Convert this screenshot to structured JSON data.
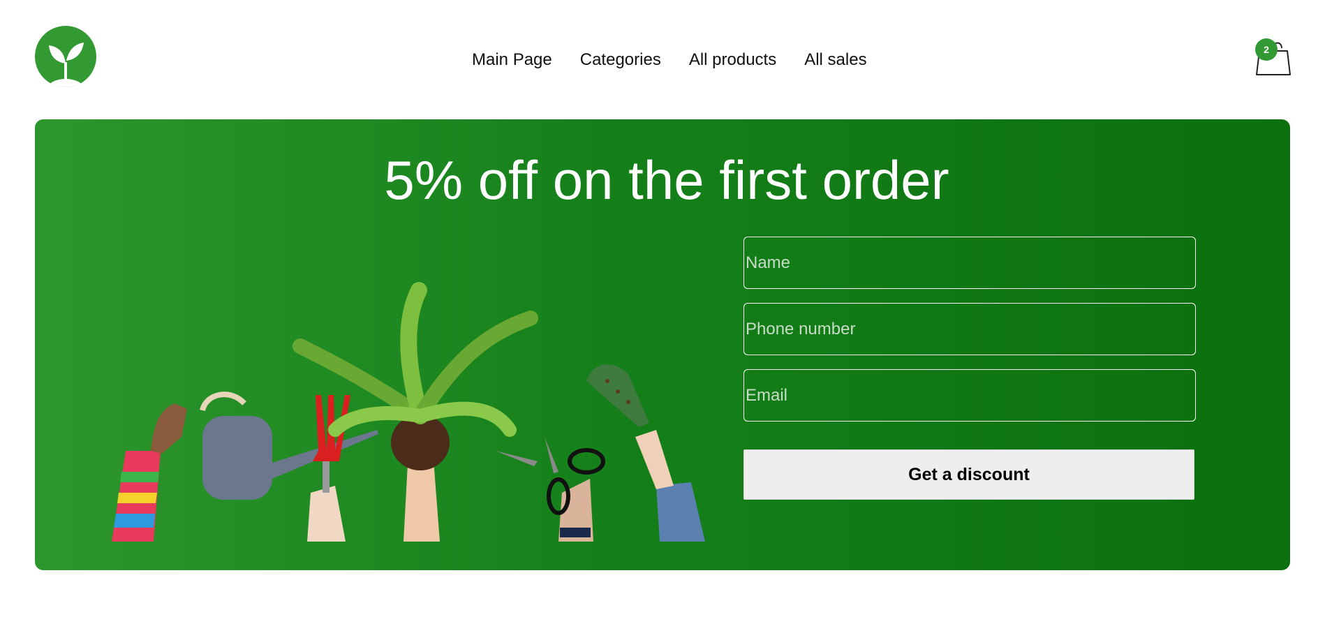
{
  "header": {
    "logo_icon": "sprout-logo-icon",
    "nav": [
      {
        "label": "Main Page"
      },
      {
        "label": "Categories"
      },
      {
        "label": "All products"
      },
      {
        "label": "All sales"
      }
    ],
    "cart": {
      "icon": "shopping-bag-icon",
      "count": "2"
    }
  },
  "banner": {
    "title": "5% off on the first order",
    "illustration": "hands-holding-garden-tools-image",
    "form": {
      "name_placeholder": "Name",
      "phone_placeholder": "Phone number",
      "email_placeholder": "Email",
      "submit_label": "Get a discount"
    }
  },
  "colors": {
    "brand_green": "#339933",
    "banner_dark": "#0b700d",
    "button_bg": "#eeeeee"
  }
}
